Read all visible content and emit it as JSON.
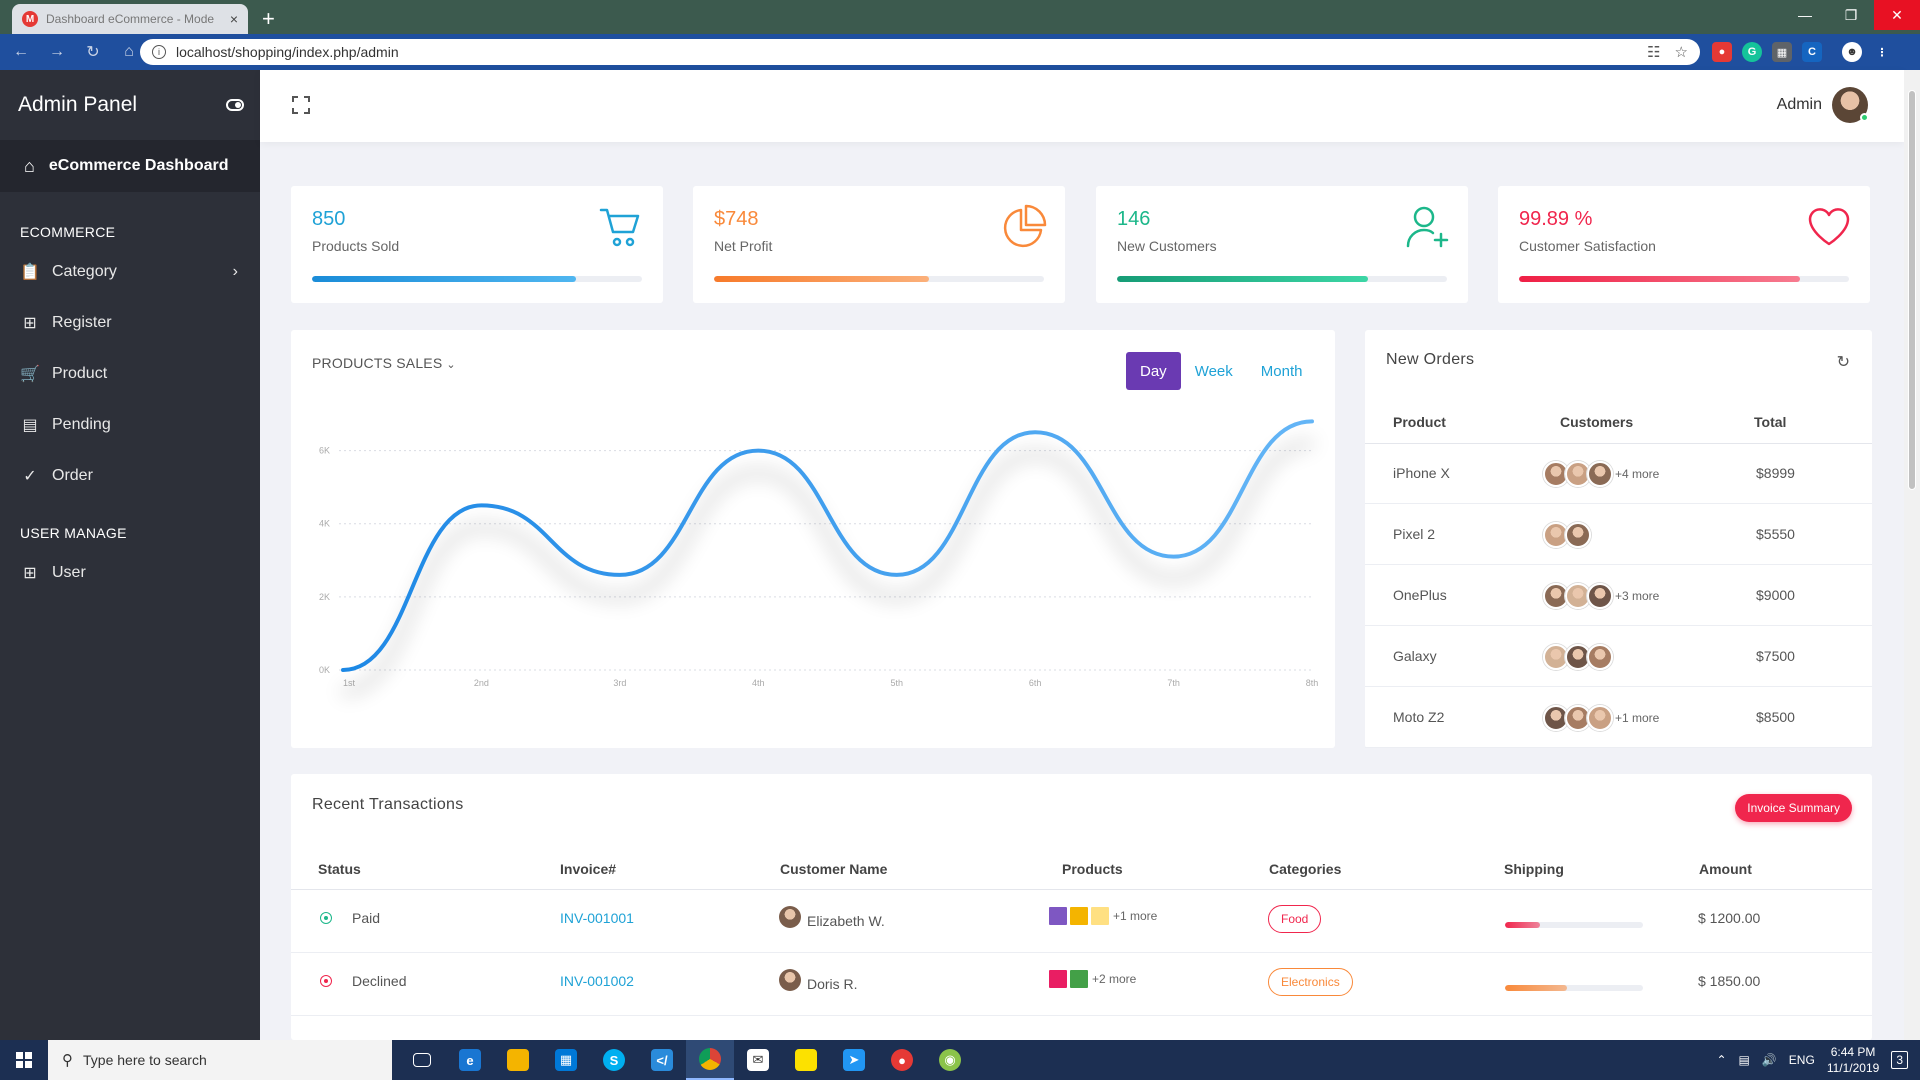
{
  "browser": {
    "tab_title": "Dashboard eCommerce - Mode",
    "favicon_letter": "M",
    "url": "localhost/shopping/index.php/admin",
    "new_tab": "+",
    "close_tab": "×"
  },
  "sidebar": {
    "title": "Admin Panel",
    "active": "eCommerce Dashboard",
    "section_ecommerce": "ECOMMERCE",
    "items_ecommerce": [
      {
        "label": "Category",
        "icon": "clipboard-icon"
      },
      {
        "label": "Register",
        "icon": "grid-icon"
      },
      {
        "label": "Product",
        "icon": "cart-icon"
      },
      {
        "label": "Pending",
        "icon": "card-icon"
      },
      {
        "label": "Order",
        "icon": "check-circle-icon"
      }
    ],
    "section_user": "USER MANAGE",
    "items_user": [
      {
        "label": "User",
        "icon": "grid-icon"
      }
    ]
  },
  "topbar": {
    "user_name": "Admin"
  },
  "stats": [
    {
      "value": "850",
      "label": "Products Sold",
      "progress": 0.8,
      "color": "#1fa2d6",
      "icon": "cart-icon"
    },
    {
      "value": "$748",
      "label": "Net Profit",
      "progress": 0.65,
      "color": "#f9893a",
      "icon": "pie-icon"
    },
    {
      "value": "146",
      "label": "New Customers",
      "progress": 0.76,
      "color": "#1cb78a",
      "icon": "user-plus-icon"
    },
    {
      "value": "99.89 %",
      "label": "Customer Satisfaction",
      "progress": 0.85,
      "color": "#f0264d",
      "icon": "heart-icon"
    }
  ],
  "sales_chart": {
    "title": "PRODUCTS SALES",
    "ranges": [
      "Day",
      "Week",
      "Month"
    ],
    "active_range": "Day"
  },
  "chart_data": {
    "type": "line",
    "x": [
      "1st",
      "2nd",
      "3rd",
      "4th",
      "5th",
      "6th",
      "7th",
      "8th"
    ],
    "y_ticks": [
      "0K",
      "2K",
      "4K",
      "6K"
    ],
    "ylim": [
      0,
      7000
    ],
    "series": [
      {
        "values": [
          0,
          4500,
          2600,
          6000,
          2600,
          6500,
          3100,
          6800
        ]
      }
    ],
    "color": "#1e88e5",
    "grid": true
  },
  "orders": {
    "title": "New Orders",
    "headers": [
      "Product",
      "Customers",
      "Total"
    ],
    "rows": [
      {
        "product": "iPhone X",
        "avatars": 3,
        "more": "+4 more",
        "total": "$8999"
      },
      {
        "product": "Pixel 2",
        "avatars": 2,
        "more": "",
        "total": "$5550"
      },
      {
        "product": "OnePlus",
        "avatars": 3,
        "more": "+3 more",
        "total": "$9000"
      },
      {
        "product": "Galaxy",
        "avatars": 3,
        "more": "",
        "total": "$7500"
      },
      {
        "product": "Moto Z2",
        "avatars": 3,
        "more": "+1 more",
        "total": "$8500"
      }
    ]
  },
  "transactions": {
    "title": "Recent Transactions",
    "button": "Invoice Summary",
    "headers": [
      "Status",
      "Invoice#",
      "Customer Name",
      "Products",
      "Categories",
      "Shipping",
      "Amount"
    ],
    "rows": [
      {
        "status": "Paid",
        "status_color": "#1cb78a",
        "invoice": "INV-001001",
        "customer": "Elizabeth W.",
        "more": "+1 more",
        "category": "Food",
        "cat_color": "#f0264d",
        "shipping": 0.25,
        "ship_color": "#f0264d",
        "amount": "$ 1200.00"
      },
      {
        "status": "Declined",
        "status_color": "#f0264d",
        "invoice": "INV-001002",
        "customer": "Doris R.",
        "more": "+2 more",
        "category": "Electronics",
        "cat_color": "#f9893a",
        "shipping": 0.45,
        "ship_color": "#f9893a",
        "amount": "$ 1850.00"
      }
    ]
  },
  "taskbar": {
    "search_placeholder": "Type here to search",
    "lang": "ENG",
    "time": "6:44 PM",
    "date": "11/1/2019",
    "notif_count": "3"
  }
}
